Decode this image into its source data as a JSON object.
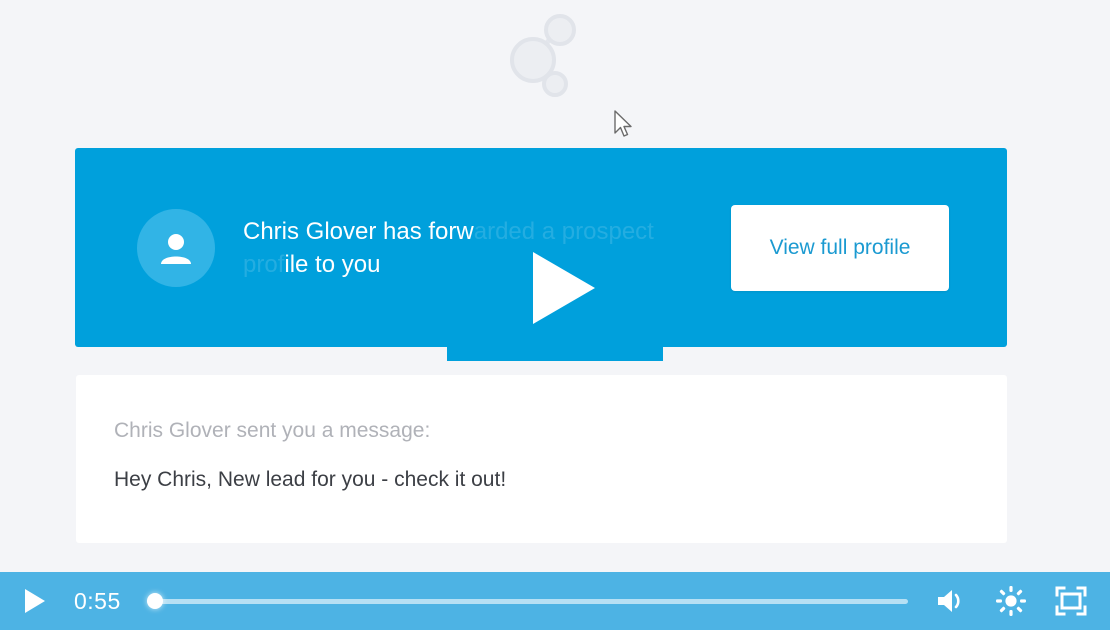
{
  "player": {
    "current_time": "0:55",
    "play_label": "Play",
    "progress_percent": 0,
    "controls": {
      "play": "play-icon",
      "volume": "volume-icon",
      "settings": "gear-icon",
      "fullscreen": "fullscreen-icon"
    }
  },
  "brand": {
    "logo_name": "node-cluster-logo",
    "logo_color": "#e3e6ec"
  },
  "banner": {
    "background_color": "#00a0dc",
    "avatar_icon": "person-icon",
    "message_visible_start": "Chris Glover has forw",
    "message_dimmed": "arded a prospect prof",
    "message_visible_end": "ile to you",
    "message_full": "Chris Glover has forwarded a prospect profile to you",
    "button_label": "View full profile",
    "button_text_color": "#1b9ad1"
  },
  "message_card": {
    "sender_line": "Chris Glover sent you a message:",
    "body_line": "Hey Chris, New lead for you - check it out!"
  },
  "overlay": {
    "big_play_icon": "play-icon"
  },
  "cursor": {
    "icon": "arrow-cursor-icon"
  }
}
